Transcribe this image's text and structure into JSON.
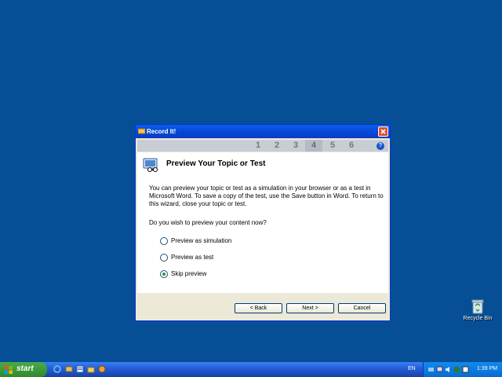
{
  "desktop": {
    "recycle_bin_label": "Recycle Bin"
  },
  "window": {
    "title": "Record It!",
    "steps": [
      "1",
      "2",
      "3",
      "4",
      "5",
      "6"
    ],
    "active_step": "4",
    "heading": "Preview Your Topic or Test",
    "description": "You can preview your topic or test as a simulation in your browser or as a test in Microsoft Word. To save a copy of the test, use the Save button in Word. To return to this wizard, close your topic or test.",
    "question": "Do you wish to preview your content now?",
    "options": [
      {
        "label": "Preview as simulation",
        "checked": false
      },
      {
        "label": "Preview as test",
        "checked": false
      },
      {
        "label": "Skip preview",
        "checked": true
      }
    ],
    "buttons": {
      "back": "< Back",
      "next": "Next >",
      "cancel": "Cancel"
    }
  },
  "taskbar": {
    "start_label": "start",
    "language": "EN",
    "clock": "1:39 PM"
  },
  "colors": {
    "desktop": "#064f97",
    "titlebar": "#0548d8",
    "start": "#2f8a2f"
  }
}
